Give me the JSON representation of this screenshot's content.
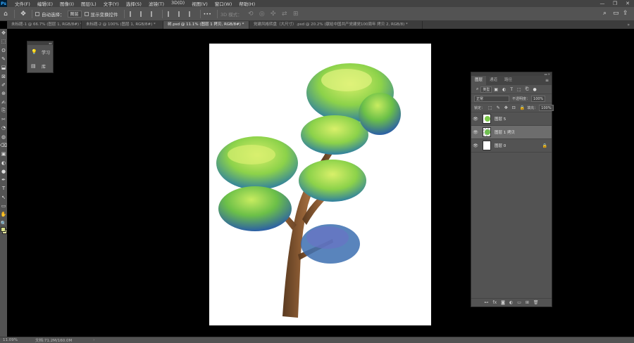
{
  "menubar": {
    "logo": "Ps",
    "items": [
      "文件(F)",
      "编辑(E)",
      "图像(I)",
      "图层(L)",
      "文字(Y)",
      "选择(S)",
      "滤镜(T)",
      "3D(D)",
      "视图(V)",
      "窗口(W)",
      "帮助(H)"
    ],
    "controls": [
      "—",
      "❐",
      "✕"
    ]
  },
  "optbar": {
    "home_icon": "home-icon",
    "move_icon": "move-tool-icon",
    "auto_select_label": "自动选择：",
    "auto_select_value": "图层",
    "show_transform_label": "显示变换控件",
    "more_label": "•••",
    "mode_3d_label": "3D 模式："
  },
  "tabs": [
    {
      "label": "未标题-1 @ 66.7% (图层 1, RGB/8#) *",
      "active": false
    },
    {
      "label": "未标题-2 @ 100% (图层 1, RGB/8#) *",
      "active": false
    },
    {
      "label": "树.psd @ 11.1% (图层 1 拷贝, RGB/8#) *",
      "active": true
    },
    {
      "label": "党建风格转盘（大尺寸）.psd @ 20.2% (献给中国共产党建党100周年 拷贝 2, RGB/8) *",
      "active": false
    }
  ],
  "tools": [
    "✥",
    "⬚",
    "ʘ",
    "✎",
    "⬓",
    "⊠",
    "✐",
    "⊕",
    "✍",
    "⎘",
    "✂",
    "◔",
    "◍",
    "⌫",
    "▣",
    "◐",
    "●",
    "✒",
    "T",
    "↖",
    "▭",
    "✋",
    "🔍",
    "⋯"
  ],
  "colors": {
    "foreground": "#d8e08a",
    "background": "#e6e6a0",
    "canvas": "#ffffff"
  },
  "learn_panel": {
    "items": [
      {
        "icon": "lightbulb-icon",
        "label": "学习"
      },
      {
        "icon": "library-icon",
        "label": "库"
      }
    ]
  },
  "layers_panel": {
    "tabs": [
      "图层",
      "通道",
      "路径"
    ],
    "filter_kind": "类型",
    "blend_mode": "正常",
    "opacity_label": "不透明度：",
    "opacity_value": "100%",
    "lock_label": "锁定：",
    "fill_label": "填充：",
    "fill_value": "100%",
    "layers": [
      {
        "name": "图层 5",
        "selected": false,
        "thumb": "t5",
        "locked": false
      },
      {
        "name": "图层 1 拷贝",
        "selected": true,
        "thumb": "tcopy",
        "locked": false
      },
      {
        "name": "图层 0",
        "selected": false,
        "thumb": "white",
        "locked": true
      }
    ],
    "footer_icons": [
      "link-icon",
      "fx-icon",
      "mask-icon",
      "adjustment-icon",
      "folder-icon",
      "new-layer-icon",
      "trash-icon"
    ]
  },
  "status": {
    "zoom": "11.09%",
    "doc_info": "文档:71.2M/160.0M"
  }
}
